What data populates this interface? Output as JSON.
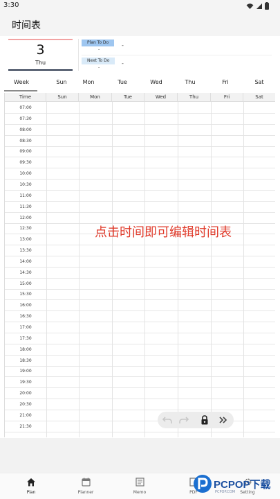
{
  "status_bar": {
    "time": "3:30",
    "icons": [
      "wifi-icon",
      "signal-icon",
      "battery-icon"
    ]
  },
  "app_bar": {
    "title": "时间表"
  },
  "date_card": {
    "day_number": "3",
    "day_name": "Thu"
  },
  "plans": [
    {
      "tag": "Plan To Do",
      "value": "-",
      "value2": "-"
    },
    {
      "tag": "Next To Do",
      "value": "-",
      "value2": "-"
    }
  ],
  "week_tabs": [
    {
      "label": "Week",
      "active": true
    },
    {
      "label": "Sun"
    },
    {
      "label": "Mon"
    },
    {
      "label": "Tue"
    },
    {
      "label": "Wed"
    },
    {
      "label": "Thu"
    },
    {
      "label": "Fri"
    },
    {
      "label": "Sat"
    }
  ],
  "grid": {
    "headers": [
      "Time",
      "Sun",
      "Mon",
      "Tue",
      "Wed",
      "Thu",
      "Fri",
      "Sat"
    ],
    "times": [
      "07:00",
      "07:30",
      "08:00",
      "08:30",
      "09:00",
      "09:30",
      "10:00",
      "10:30",
      "11:00",
      "11:30",
      "12:00",
      "12:30",
      "13:00",
      "13:30",
      "14:00",
      "14:30",
      "15:00",
      "15:30",
      "16:00",
      "16:30",
      "17:00",
      "17:30",
      "18:00",
      "18:30",
      "19:00",
      "19:30",
      "20:00",
      "20:30",
      "21:00",
      "21:30"
    ]
  },
  "overlay_hint": "点击时间即可编辑时间表",
  "toolbar": {
    "icons": [
      "undo-icon",
      "redo-icon",
      "lock-icon",
      "double-chevron-right-icon"
    ]
  },
  "bottom_nav": [
    {
      "label": "Plan",
      "icon": "home-icon",
      "active": true
    },
    {
      "label": "Planner",
      "icon": "calendar-icon"
    },
    {
      "label": "Memo",
      "icon": "memo-icon"
    },
    {
      "label": "PDF",
      "icon": "pdf-icon"
    },
    {
      "label": "Setting",
      "icon": "gear-icon"
    }
  ],
  "watermark": {
    "text": "PCPOP下载",
    "subtext": "PCPOP.COM"
  },
  "colors": {
    "accent_red": "#e03a2a",
    "plan_tag": "#9ec6f0",
    "next_tag": "#d9eaf8",
    "card_top": "#f2a3a3",
    "card_bottom": "#2e3a4f",
    "watermark_blue": "#1b4fa0"
  }
}
